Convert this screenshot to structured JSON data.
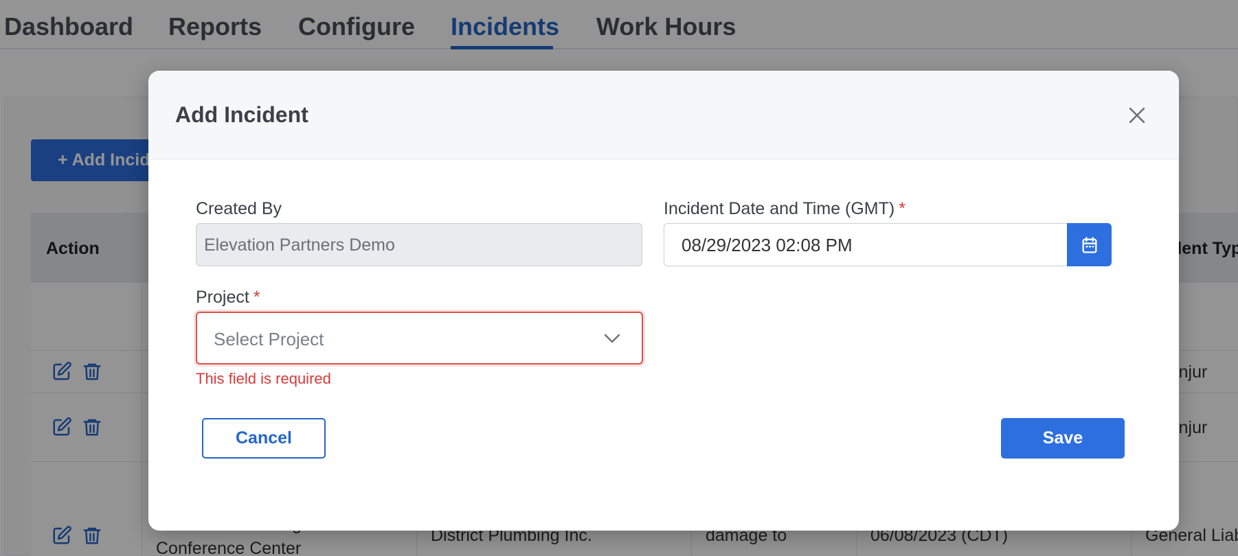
{
  "nav": {
    "tabs": [
      {
        "label": "Dashboard"
      },
      {
        "label": "Reports"
      },
      {
        "label": "Configure"
      },
      {
        "label": "Incidents",
        "active": true
      },
      {
        "label": "Work Hours"
      }
    ]
  },
  "toolbar": {
    "add_label": "+ Add Incid"
  },
  "table": {
    "headers": {
      "action": "Action",
      "incident_type": "dent Typ"
    },
    "rows": [
      {
        "incident_type": "ker Injur"
      },
      {
        "incident_type": "ker Injur"
      },
      {
        "project_line1": "Conference Center",
        "project_line1_partial": "g",
        "contractor": "District Plumbing Inc.",
        "description": "damage to",
        "date": "06/08/2023 (CDT)",
        "incident_type": "General Liab"
      }
    ]
  },
  "modal": {
    "title": "Add Incident",
    "created_by_label": "Created By",
    "created_by_value": "Elevation Partners Demo",
    "incident_date_label": "Incident Date and Time (GMT)",
    "incident_date_value": "08/29/2023 02:08 PM",
    "project_label": "Project",
    "project_placeholder": "Select Project",
    "required_marker": "*",
    "project_error": "This field is required",
    "cancel_label": "Cancel",
    "save_label": "Save"
  },
  "icons": {
    "close": "close-icon",
    "calendar": "calendar-icon",
    "chevron": "chevron-down-icon",
    "edit": "edit-icon",
    "delete": "trash-icon"
  },
  "colors": {
    "accent": "#2e6fe0",
    "active_tab": "#2566c8",
    "error": "#d63a3a",
    "overlay": "rgba(0,0,0,0.42)"
  }
}
